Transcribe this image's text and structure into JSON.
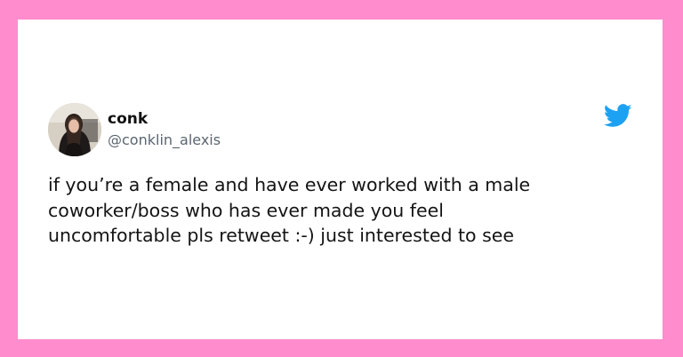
{
  "tweet": {
    "display_name": "conk",
    "handle": "@conklin_alexis",
    "text": "if you’re a female and have ever worked with a male\ncoworker/boss who has ever made you feel\nuncomfortable pls retweet :-) just interested to see"
  },
  "icons": {
    "brand": "twitter-bird-icon",
    "avatar": "user-avatar"
  },
  "colors": {
    "frame": "#ff8ccc",
    "card": "#ffffff",
    "twitter_blue": "#1da1f2",
    "handle_gray": "#5b6570",
    "text": "#141414"
  }
}
